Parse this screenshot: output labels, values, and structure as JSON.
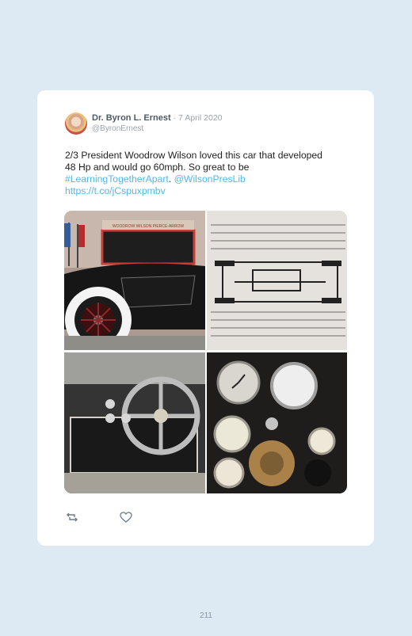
{
  "tweet": {
    "author_name": "Dr. Byron L. Ernest",
    "date": "· 7 April 2020",
    "handle": "@ByronErnest",
    "text_main": "2/3 President Woodrow Wilson loved this car that developed 48 Hp and would go 60mph. So great to be ",
    "hashtag": "#LearningTogetherApart",
    "separator": ". ",
    "mention": "@WilsonPresLib",
    "url": "https://t.co/jCspuxpmbv",
    "photo_caption": "WOODROW WILSON PIERCE-ARROW"
  },
  "actions": {
    "retweet_icon": "retweet-icon",
    "like_icon": "heart-icon"
  },
  "page_number": "211",
  "colors": {
    "background": "#dde9f3",
    "card": "#ffffff",
    "link": "#55b6e6",
    "muted": "#9aa3aa"
  }
}
